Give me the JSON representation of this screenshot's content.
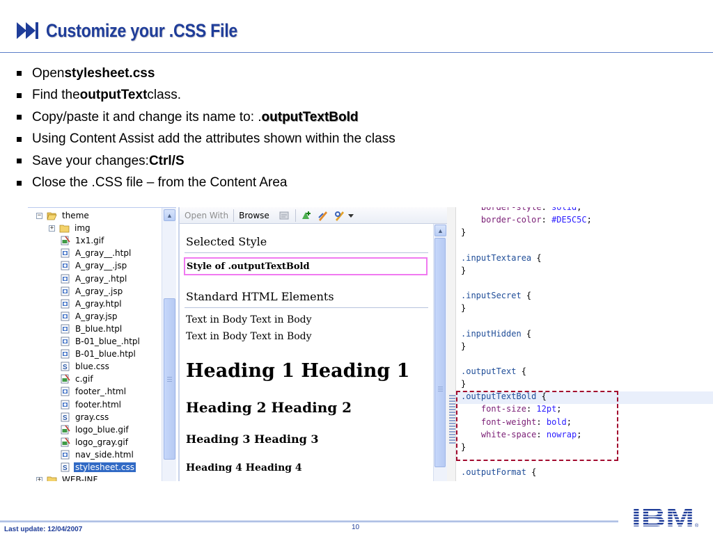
{
  "slide": {
    "title": "Customize your .CSS File",
    "bullets": [
      {
        "pre": "Open ",
        "bold": "stylesheet.css",
        "post": ""
      },
      {
        "pre": "Find the ",
        "bold": "outputText",
        "post": " class."
      },
      {
        "pre": "Copy/paste it and change its name to: .",
        "bold": "outputTextBold",
        "post": ""
      },
      {
        "pre": "Using Content Assist add the attributes shown within the class",
        "bold": "",
        "post": ""
      },
      {
        "pre": "Save your changes:  ",
        "bold": "Ctrl/S",
        "post": ""
      },
      {
        "pre": "Close the .CSS file – from the Content Area",
        "bold": "",
        "post": ""
      }
    ],
    "footer": {
      "last_update": "Last update: 12/04/2007",
      "page_number": "10",
      "logo": "IBM"
    }
  },
  "tree": {
    "items": [
      {
        "label": "theme",
        "icon": "folder-open-icon",
        "expander": "−",
        "indent": 0
      },
      {
        "label": "img",
        "icon": "folder-icon",
        "expander": "+",
        "indent": 1
      },
      {
        "label": "1x1.gif",
        "icon": "image-file-icon",
        "indent": 1
      },
      {
        "label": "A_gray__.htpl",
        "icon": "html-file-icon",
        "indent": 1
      },
      {
        "label": "A_gray__.jsp",
        "icon": "html-file-icon",
        "indent": 1
      },
      {
        "label": "A_gray_.htpl",
        "icon": "html-file-icon",
        "indent": 1
      },
      {
        "label": "A_gray_.jsp",
        "icon": "html-file-icon",
        "indent": 1
      },
      {
        "label": "A_gray.htpl",
        "icon": "html-file-icon",
        "indent": 1
      },
      {
        "label": "A_gray.jsp",
        "icon": "html-file-icon",
        "indent": 1
      },
      {
        "label": "B_blue.htpl",
        "icon": "html-file-icon",
        "indent": 1
      },
      {
        "label": "B-01_blue_.htpl",
        "icon": "html-file-icon",
        "indent": 1
      },
      {
        "label": "B-01_blue.htpl",
        "icon": "html-file-icon",
        "indent": 1
      },
      {
        "label": "blue.css",
        "icon": "css-file-icon",
        "indent": 1
      },
      {
        "label": "c.gif",
        "icon": "image-file-icon",
        "indent": 1
      },
      {
        "label": "footer_.html",
        "icon": "html-file-icon",
        "indent": 1
      },
      {
        "label": "footer.html",
        "icon": "html-file-icon",
        "indent": 1
      },
      {
        "label": "gray.css",
        "icon": "css-file-icon",
        "indent": 1
      },
      {
        "label": "logo_blue.gif",
        "icon": "image-file-icon",
        "indent": 1
      },
      {
        "label": "logo_gray.gif",
        "icon": "image-file-icon",
        "indent": 1
      },
      {
        "label": "nav_side.html",
        "icon": "html-file-icon",
        "indent": 1
      },
      {
        "label": "stylesheet.css",
        "icon": "css-file-icon",
        "indent": 1,
        "selected": true
      },
      {
        "label": "WEB-INF",
        "icon": "folder-icon",
        "expander": "+",
        "indent": 0
      }
    ]
  },
  "preview": {
    "toolbar": {
      "open_with": "Open With",
      "browse": "Browse",
      "icons": [
        "style-icon",
        "add-style-icon",
        "edit-style-icon",
        "link-style-icon",
        "dropdown-arrow-icon"
      ]
    },
    "selected_style_heading": "Selected Style",
    "selected_style_sample": "Style of .outputTextBold",
    "std_heading": "Standard HTML Elements",
    "body_line_1": "Text in Body Text in Body",
    "body_line_2": "Text in Body Text in Body",
    "h1": "Heading 1 Heading 1",
    "h2": "Heading 2 Heading 2",
    "h3": "Heading 3 Heading 3",
    "h4": "Heading 4 Heading 4"
  },
  "code": {
    "lines": [
      {
        "indent": "    ",
        "prop": "border-style",
        "val": "solid"
      },
      {
        "indent": "    ",
        "prop": "border-color",
        "val": "#DE5C5C"
      },
      {
        "text": "}"
      },
      {
        "text": ""
      },
      {
        "sel": ".inputTextarea",
        "tail": " {"
      },
      {
        "text": "}"
      },
      {
        "text": ""
      },
      {
        "sel": ".inputSecret",
        "tail": " {"
      },
      {
        "text": "}"
      },
      {
        "text": ""
      },
      {
        "sel": ".inputHidden",
        "tail": " {"
      },
      {
        "text": "}"
      },
      {
        "text": ""
      },
      {
        "sel": ".outputText",
        "tail": " {"
      },
      {
        "text": "}"
      },
      {
        "sel": ".outputTextBold",
        "tail": " {",
        "current": true
      },
      {
        "indent": "    ",
        "prop": "font-size",
        "val": "12pt"
      },
      {
        "indent": "    ",
        "prop": "font-weight",
        "val": "bold"
      },
      {
        "indent": "    ",
        "prop": "white-space",
        "val": "nowrap"
      },
      {
        "text": "}"
      },
      {
        "text": ""
      },
      {
        "sel": ".outputFormat",
        "tail": " {"
      }
    ]
  },
  "colors": {
    "title": "#1f3d99",
    "highlight_box": "#f079f0",
    "dashed_box": "#a20a2e",
    "selection": "#316ac5",
    "css_selector": "#1f4d98",
    "css_property": "#7a1d75",
    "css_value": "#2a1cff"
  }
}
